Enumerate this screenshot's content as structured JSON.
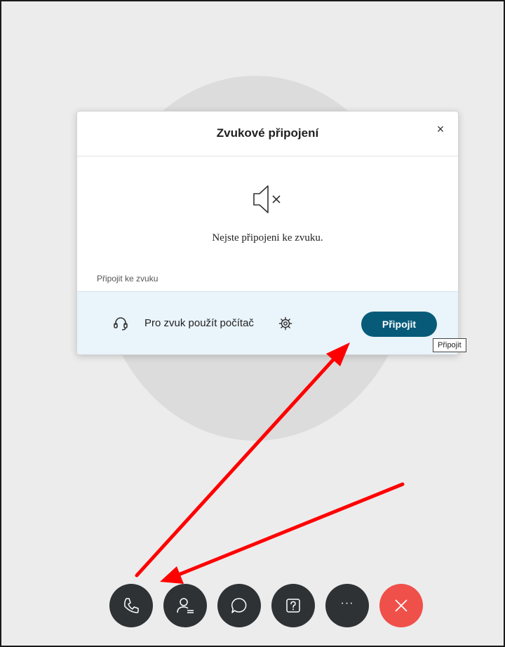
{
  "dialog": {
    "title": "Zvukové připojení",
    "close_glyph": "×",
    "status_icon": "speaker-muted-icon",
    "status_text": "Nejste připojeni ke zvuku.",
    "section_label": "Připojit ke zvuku",
    "option": {
      "icon": "headset-icon",
      "label": "Pro zvuk použít počítač",
      "settings_icon": "gear-icon"
    },
    "connect_label": "Připojit"
  },
  "tooltip": {
    "text": "Připojit"
  },
  "toolbar": {
    "buttons": [
      {
        "name": "audio",
        "icon": "phone-icon"
      },
      {
        "name": "participants",
        "icon": "participants-icon"
      },
      {
        "name": "chat",
        "icon": "chat-icon"
      },
      {
        "name": "qa",
        "icon": "question-icon"
      },
      {
        "name": "more",
        "icon": "more-icon",
        "glyph": "···"
      },
      {
        "name": "leave",
        "icon": "close-icon"
      }
    ]
  },
  "colors": {
    "accent": "#075b79",
    "leave": "#f0504a",
    "toolbar_button": "#2f3235",
    "annotation_arrow": "#ff0000",
    "panel_bg": "#eaf4fb",
    "stage_bg": "#ececec",
    "avatar_bg": "#dcdcdc"
  }
}
